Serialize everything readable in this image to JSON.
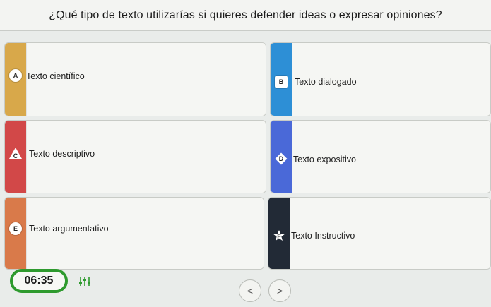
{
  "question": {
    "text": "¿Qué tipo de texto utilizarías si quieres defender ideas o expresar opiniones?"
  },
  "options": [
    {
      "letter": "A",
      "label": "Texto científico",
      "color": "#d8a84a",
      "shape": "circle"
    },
    {
      "letter": "B",
      "label": "Texto dialogado",
      "color": "#2d8fd6",
      "shape": "square"
    },
    {
      "letter": "C",
      "label": "Texto descriptivo",
      "color": "#d24848",
      "shape": "triangle"
    },
    {
      "letter": "D",
      "label": "Texto expositivo",
      "color": "#4a69d8",
      "shape": "diamond"
    },
    {
      "letter": "E",
      "label": "Texto argumentativo",
      "color": "#d97a4a",
      "shape": "circle"
    },
    {
      "letter": "F",
      "label": "Texto Instructivo",
      "color": "#222a36",
      "shape": "star"
    }
  ],
  "footer": {
    "timer": "06:35",
    "settings_icon": "sliders-icon",
    "prev_icon": "chevron-left-icon",
    "next_icon": "chevron-right-icon",
    "prev_symbol": "<",
    "next_symbol": ">",
    "accent": "#2e9a2e"
  }
}
